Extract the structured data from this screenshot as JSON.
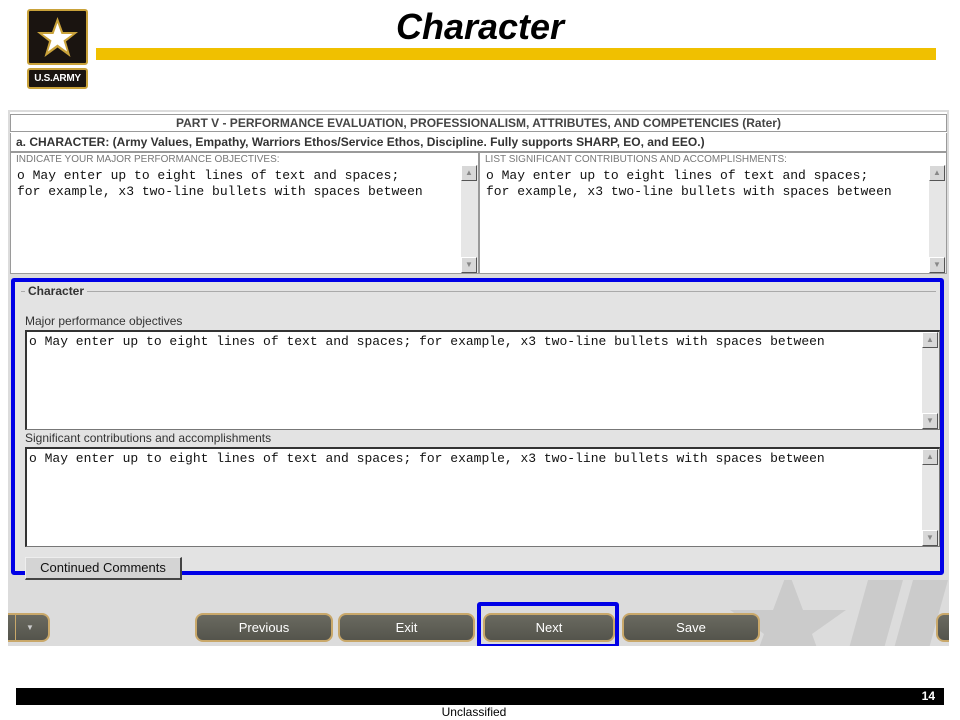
{
  "header": {
    "title": "Character",
    "logo_text": "U.S.ARMY"
  },
  "form": {
    "part_header": "PART V - PERFORMANCE EVALUATION, PROFESSIONALISM, ATTRIBUTES, AND COMPETENCIES (Rater)",
    "character_header": "a. CHARACTER: (Army Values, Empathy, Warriors Ethos/Service Ethos, Discipline. Fully supports SHARP, EO, and EEO.)",
    "left_col": {
      "label": "INDICATE YOUR MAJOR PERFORMANCE OBJECTIVES:",
      "text": "o May enter up to eight lines of text and spaces;\nfor example, x3 two-line bullets with spaces between"
    },
    "right_col": {
      "label": "LIST SIGNIFICANT CONTRIBUTIONS AND ACCOMPLISHMENTS:",
      "text": "o May enter up to eight lines of text and spaces;\nfor example, x3 two-line bullets with spaces between"
    }
  },
  "character_group": {
    "legend": "Character",
    "objectives_label": "Major performance objectives",
    "objectives_text": "o May enter up to eight lines of text and spaces; for example, x3 two-line bullets with spaces between",
    "contributions_label": "Significant contributions and accomplishments",
    "contributions_text": "o May enter up to eight lines of text and spaces; for example, x3 two-line bullets with spaces between",
    "continued_comments_label": "Continued Comments"
  },
  "nav": {
    "previous_label": "Previous",
    "exit_label": "Exit",
    "next_label": "Next",
    "save_label": "Save"
  },
  "scroll_icons": {
    "up": "▲",
    "down": "▼"
  },
  "footer": {
    "page_number": "14",
    "classification": "Unclassified"
  },
  "colors": {
    "highlight": "#0000e6",
    "gold_bar": "#f0c000",
    "nav_button": "#5e5e56"
  }
}
